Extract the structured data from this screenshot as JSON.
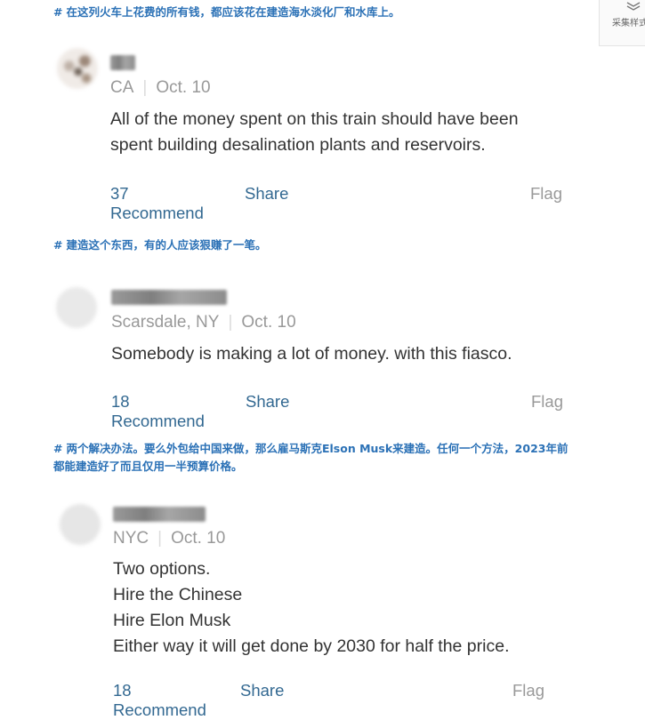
{
  "side_tool": {
    "label": "采集样式",
    "icon": "layers-icon"
  },
  "annotations": [
    {
      "hash": "#",
      "text": "在这列火车上花费的所有钱，都应该花在建造海水淡化厂和水库上。"
    },
    {
      "hash": "#",
      "text": "建造这个东西，有的人应该狠赚了一笔。"
    },
    {
      "hash": "#",
      "text": "两个解决办法。要么外包给中国来做，那么雇马斯克Elson Musk来建造。任何一个方法，2023年前都能建造好了而且仅用一半预算价格。"
    }
  ],
  "comments": [
    {
      "username": "███",
      "location": "CA",
      "date": "Oct. 10",
      "body": [
        "All of the money spent on this train should have been spent building desalination plants and reservoirs."
      ],
      "recommend": "37 Recommend",
      "share": "Share",
      "flag": "Flag"
    },
    {
      "username": "██████████",
      "location": "Scarsdale, NY",
      "date": "Oct. 10",
      "body": [
        "Somebody is making a lot of money. with this fiasco."
      ],
      "recommend": "18 Recommend",
      "share": "Share",
      "flag": "Flag"
    },
    {
      "username": "███ ██████",
      "location": "NYC",
      "date": "Oct. 10",
      "body": [
        "Two options.",
        "Hire the Chinese",
        "Hire Elon Musk",
        "Either way it will get done by 2030 for half the price."
      ],
      "recommend": "18 Recommend",
      "share": "Share",
      "flag": "Flag"
    }
  ]
}
